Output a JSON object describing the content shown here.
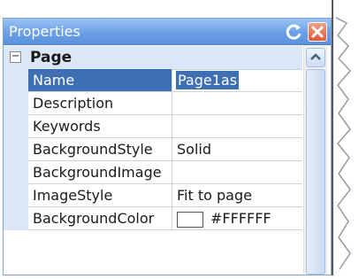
{
  "window": {
    "title": "Properties",
    "pin_icon": "refresh-pin-icon",
    "close_icon": "close-icon",
    "title_color": "#6aa0e6"
  },
  "category": {
    "expander": "−",
    "label": "Page"
  },
  "properties": [
    {
      "name": "Name",
      "value": "Page1as",
      "selected": true
    },
    {
      "name": "Description",
      "value": ""
    },
    {
      "name": "Keywords",
      "value": ""
    },
    {
      "name": "BackgroundStyle",
      "value": "Solid"
    },
    {
      "name": "BackgroundImage",
      "value": ""
    },
    {
      "name": "ImageStyle",
      "value": "Fit to page"
    },
    {
      "name": "BackgroundColor",
      "value": "#FFFFFF",
      "swatch": "#FFFFFF"
    }
  ],
  "colors": {
    "selection": "#3f6fb3",
    "gutter": "#dbe6f6"
  }
}
